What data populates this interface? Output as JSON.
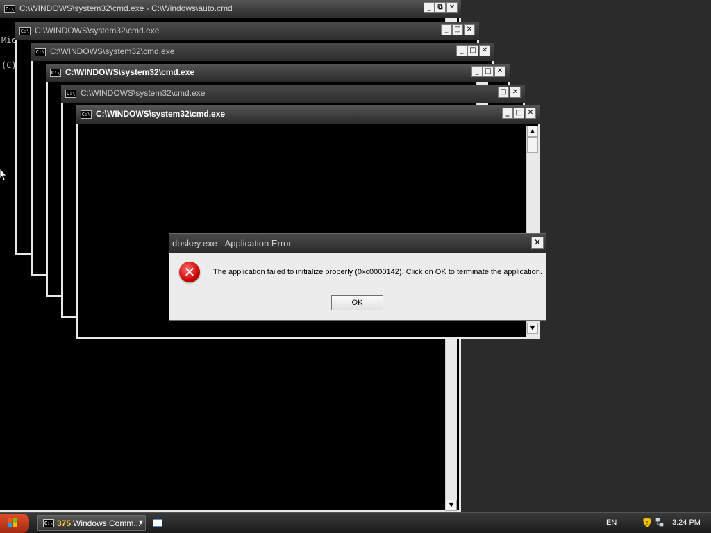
{
  "windows": [
    {
      "title": "C:\\WINDOWS\\system32\\cmd.exe - C:\\Windows\\auto.cmd",
      "console_lines": [
        "Mic",
        "(C)"
      ]
    },
    {
      "title": "C:\\WINDOWS\\system32\\cmd.exe"
    },
    {
      "title": "C:\\WINDOWS\\system32\\cmd.exe"
    },
    {
      "title": "C:\\WINDOWS\\system32\\cmd.exe"
    },
    {
      "title": "C:\\WINDOWS\\system32\\cmd.exe"
    },
    {
      "title": "C:\\WINDOWS\\system32\\cmd.exe"
    }
  ],
  "window_icon": "C:\\",
  "controls": {
    "minimize": "_",
    "maximize": "□",
    "restore": "⧉",
    "close": "✕"
  },
  "dialog": {
    "title": "doskey.exe - Application Error",
    "message": "The application failed to initialize properly (0xc0000142). Click on OK to terminate the application.",
    "ok_label": "OK",
    "icon": "error-icon",
    "icon_glyph": "✕"
  },
  "taskbar": {
    "group_count": "375",
    "group_label": "Windows Comm...",
    "language": "EN",
    "clock": "3:24 PM"
  },
  "colors": {
    "titlebar": "#2d2d2d",
    "frame": "#e8e8e8",
    "console_bg": "#000000",
    "error_red": "#c40000"
  }
}
